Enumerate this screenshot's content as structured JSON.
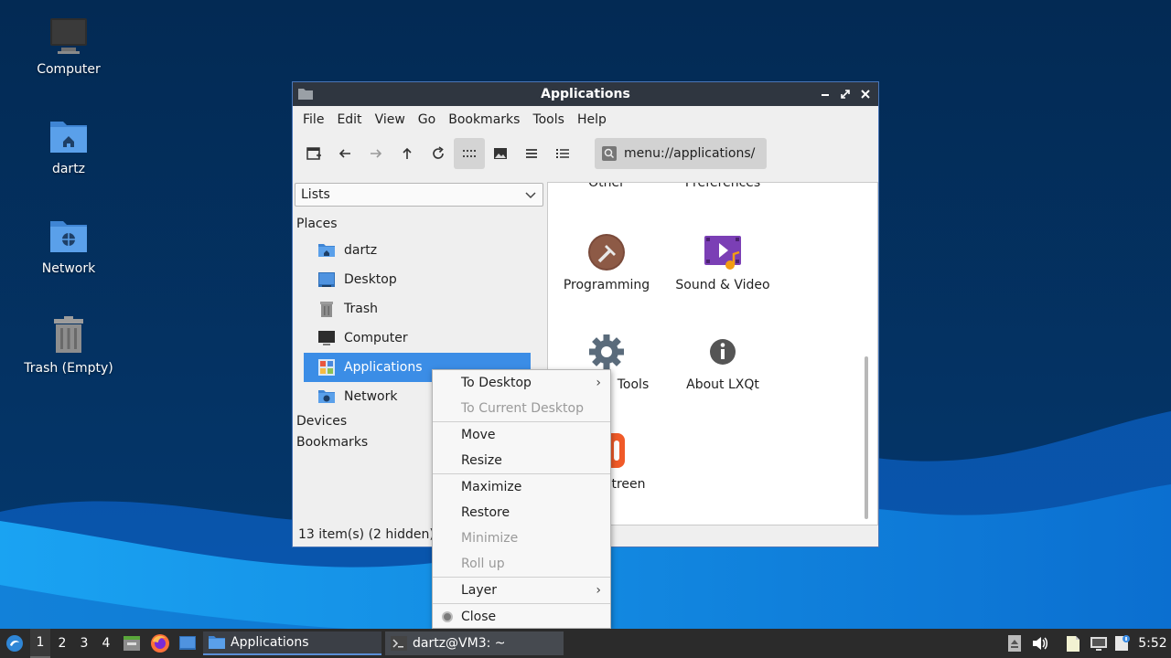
{
  "window": {
    "title": "Applications",
    "menu": [
      "File",
      "Edit",
      "View",
      "Go",
      "Bookmarks",
      "Tools",
      "Help"
    ],
    "path": "menu://applications/",
    "side_pane_mode": "Lists",
    "places_header": "Places",
    "places": [
      "dartz",
      "Desktop",
      "Trash",
      "Computer",
      "Applications",
      "Network"
    ],
    "devices_header": "Devices",
    "bookmarks_header": "Bookmarks",
    "status": "13 item(s) (2 hidden)",
    "tiles": [
      {
        "label": "Other",
        "icon": "folder-icon"
      },
      {
        "label": "Preferences",
        "icon": "preferences-icon"
      },
      {
        "label": "Programming",
        "icon": "hammer-icon"
      },
      {
        "label": "Sound & Video",
        "icon": "multimedia-icon"
      },
      {
        "label": "Tools",
        "icon": "gear-icon"
      },
      {
        "label": "About LXQt",
        "icon": "info-icon"
      },
      {
        "label": "treen",
        "icon": "screen-icon"
      }
    ]
  },
  "desktop_icons": [
    "Computer",
    "dartz",
    "Network",
    "Trash (Empty)"
  ],
  "context_menu": {
    "items": [
      {
        "label": "To Desktop",
        "disabled": false,
        "submenu": true
      },
      {
        "label": "To Current Desktop",
        "disabled": true
      },
      {
        "label": "Move",
        "disabled": false
      },
      {
        "label": "Resize",
        "disabled": false
      },
      {
        "label": "Maximize",
        "disabled": false
      },
      {
        "label": "Restore",
        "disabled": false
      },
      {
        "label": "Minimize",
        "disabled": true
      },
      {
        "label": "Roll up",
        "disabled": true
      },
      {
        "label": "Layer",
        "disabled": false,
        "submenu": true
      },
      {
        "label": "Close",
        "disabled": false
      }
    ]
  },
  "taskbar": {
    "desktops": [
      "1",
      "2",
      "3",
      "4"
    ],
    "tasks": [
      "Applications",
      "dartz@VM3: ~"
    ],
    "clock": "5:52"
  },
  "colors": {
    "accent": "#3b8de6",
    "titlebar": "#2f3640",
    "taskbar": "#2b2b2b"
  }
}
